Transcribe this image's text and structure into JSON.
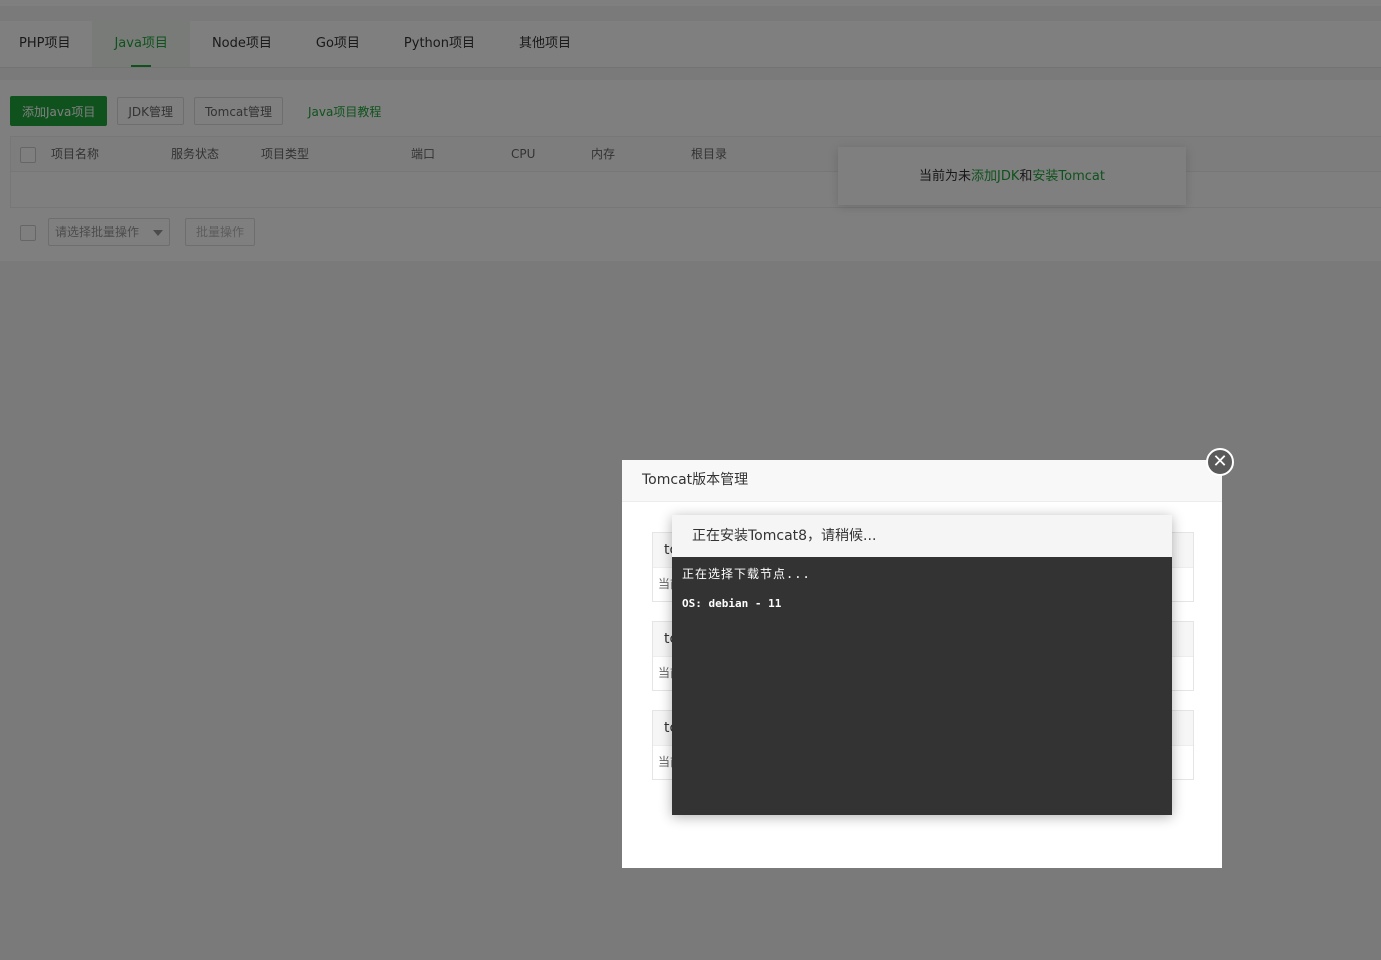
{
  "tabs": [
    "PHP项目",
    "Java项目",
    "Node项目",
    "Go项目",
    "Python项目",
    "其他项目"
  ],
  "toolbar": {
    "add_label": "添加Java项目",
    "jdk_label": "JDK管理",
    "tomcat_label": "Tomcat管理",
    "tutorial_label": "Java项目教程"
  },
  "table": {
    "headers": [
      "项目名称",
      "服务状态",
      "项目类型",
      "端口",
      "CPU",
      "内存",
      "根目录"
    ]
  },
  "batch": {
    "select_placeholder": "请选择批量操作",
    "button_label": "批量操作"
  },
  "tip": {
    "prefix": "当前为未",
    "add_jdk": "添加JDK",
    "and": "和",
    "install_tomcat": "安装Tomcat"
  },
  "dialog": {
    "title": "Tomcat版本管理",
    "cards": [
      {
        "name": "tc",
        "status": "当前"
      },
      {
        "name": "tc",
        "status": "当前"
      },
      {
        "name": "tc",
        "status": "当前"
      }
    ]
  },
  "loading": {
    "title": "正在安装Tomcat8，请稍候...",
    "log_line1": "正在选择下载节点...",
    "log_line2": "OS: debian - 11"
  },
  "icons": {
    "close": "close-icon",
    "dropdown": "chevron-down-icon"
  },
  "colors": {
    "accent": "#20a53a",
    "terminal_bg": "#333333"
  }
}
